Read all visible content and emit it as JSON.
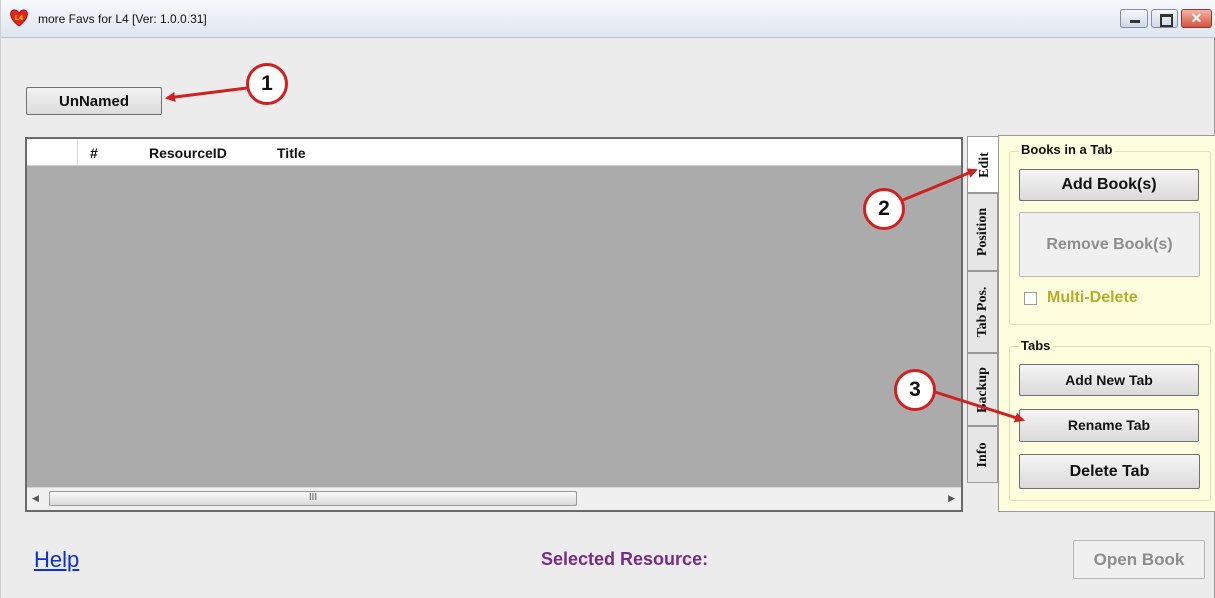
{
  "window": {
    "title": "more Favs for L4  [Ver: 1.0.0.31]",
    "icon": "L4"
  },
  "top_button": {
    "label": "UnNamed"
  },
  "grid": {
    "columns": [
      "#",
      "ResourceID",
      "Title"
    ],
    "scroll_thumb": "III"
  },
  "side_tabs": [
    "Edit",
    "Position",
    "Tab Pos.",
    "Backup",
    "Info"
  ],
  "books_group": {
    "label": "Books in a Tab",
    "add_label": "Add Book(s)",
    "remove_label": "Remove Book(s)",
    "multi_delete_label": "Multi-Delete"
  },
  "tabs_group": {
    "label": "Tabs",
    "add_label": "Add New Tab",
    "rename_label": "Rename Tab",
    "delete_label": "Delete Tab"
  },
  "footer": {
    "help_label": "Help",
    "selected_resource_label": "Selected Resource:",
    "open_book_label": "Open Book"
  },
  "callouts": [
    "1",
    "2",
    "3"
  ],
  "colors": {
    "callout_red": "#d02020",
    "panel_bg": "#fefede",
    "help_link": "#0b30d4",
    "selected_resource": "#7a2a8a"
  }
}
